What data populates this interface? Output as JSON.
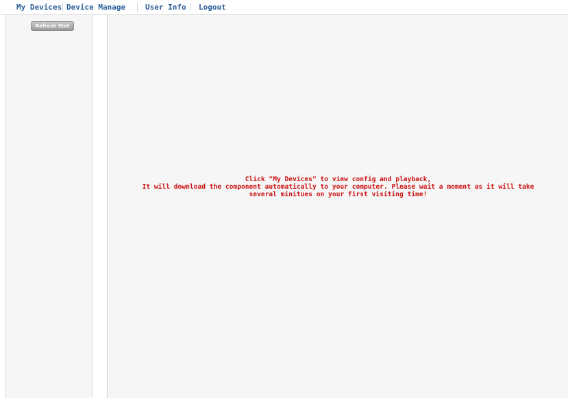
{
  "nav": {
    "items": [
      {
        "label": "My Devices"
      },
      {
        "label": "Device Manage"
      },
      {
        "label": "User Info"
      },
      {
        "label": "Logout"
      }
    ]
  },
  "sidebar": {
    "refresh_label": "Refresh Stat"
  },
  "main": {
    "message_lines": [
      "Click \"My Devices\" to view config and playback,",
      "It will download the component automatically to your computer. Please wait a moment as it will take",
      "several minitues on your first visiting time!"
    ]
  },
  "colors": {
    "nav_text": "#2a5e9a",
    "message_text": "#cc1111",
    "panel_bg": "#f6f6f6"
  }
}
